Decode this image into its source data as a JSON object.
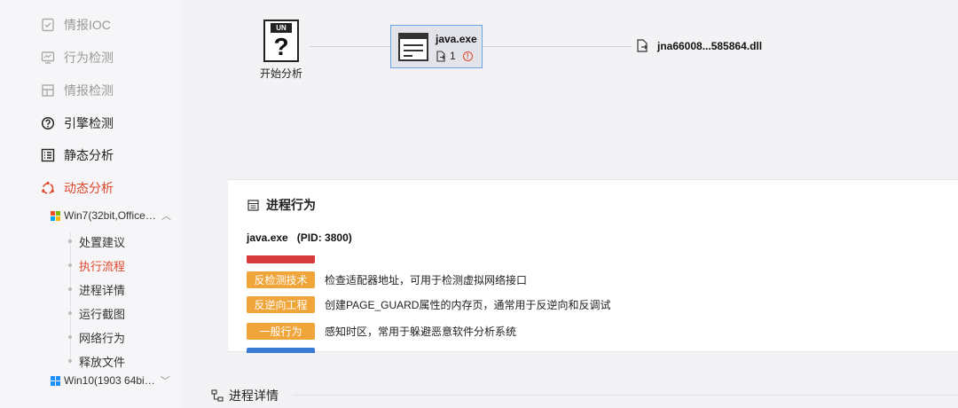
{
  "sidebar": {
    "items": [
      {
        "label": "情报IOC",
        "icon": "checklist-icon",
        "state": "muted"
      },
      {
        "label": "行为检测",
        "icon": "monitor-icon",
        "state": "muted"
      },
      {
        "label": "情报检测",
        "icon": "layout-icon",
        "state": "muted"
      },
      {
        "label": "引擎检测",
        "icon": "question-circle-icon",
        "state": "normal"
      },
      {
        "label": "静态分析",
        "icon": "list-icon",
        "state": "normal"
      },
      {
        "label": "动态分析",
        "icon": "radar-icon",
        "state": "active"
      }
    ],
    "env_groups": [
      {
        "label": "Win7(32bit,Office…",
        "expanded": true
      },
      {
        "label": "Win10(1903 64bi…",
        "expanded": false
      }
    ],
    "sub_items": [
      "处置建议",
      "执行流程",
      "进程详情",
      "运行截图",
      "网络行为",
      "释放文件"
    ],
    "active_sub": "执行流程"
  },
  "graph": {
    "start": {
      "badge": "UN",
      "glyph": "?",
      "label": "开始分析"
    },
    "process": {
      "name": "java.exe",
      "file_count": "1"
    },
    "dll": {
      "name": "jna66008...585864.dll"
    }
  },
  "behavior": {
    "title": "进程行为",
    "process": "java.exe",
    "pid": "(PID: 3800)",
    "rows": [
      {
        "tag": "",
        "color": "#d63a3a",
        "desc": ""
      },
      {
        "tag": "反检测技术",
        "color": "#f0a53a",
        "desc": "检查适配器地址，可用于检测虚拟网络接口"
      },
      {
        "tag": "反逆向工程",
        "color": "#f0a53a",
        "desc": "创建PAGE_GUARD属性的内存页，通常用于反逆向和反调试"
      },
      {
        "tag": "一般行为",
        "color": "#f0a53a",
        "desc": "感知时区，常用于躲避恶意软件分析系统"
      },
      {
        "tag": "",
        "color": "#3a7bd6",
        "desc": ""
      }
    ]
  },
  "bottom": {
    "title": "进程详情"
  },
  "colors": {
    "accent": "#e0462a",
    "warning_tag": "#f0a53a",
    "node_border": "#6aa3e6"
  }
}
